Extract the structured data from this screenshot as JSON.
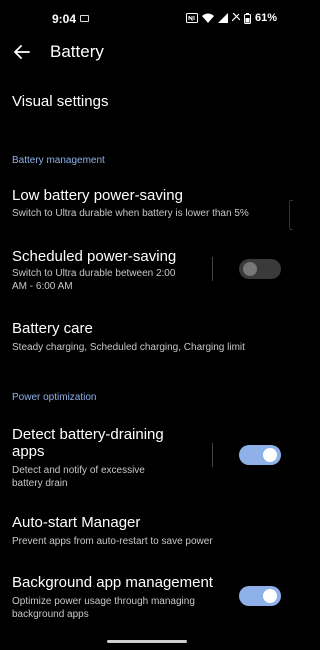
{
  "status_bar": {
    "time": "9:04",
    "battery_percent": "61%"
  },
  "app_bar": {
    "title": "Battery"
  },
  "visual_settings": {
    "title": "Visual settings"
  },
  "battery_management": {
    "header": "Battery management",
    "low_battery": {
      "title": "Low battery power-saving",
      "subtitle": "Switch to Ultra durable when battery is lower than 5%"
    },
    "scheduled": {
      "title": "Scheduled power-saving",
      "subtitle_line1": "Switch to Ultra durable between 2:00",
      "subtitle_line2": "AM - 6:00 AM",
      "enabled": false
    },
    "battery_care": {
      "title": "Battery care",
      "subtitle": "Steady charging, Scheduled charging, Charging limit"
    }
  },
  "power_optimization": {
    "header": "Power optimization",
    "detect": {
      "title_line1": "Detect battery-draining",
      "title_line2": "apps",
      "subtitle_line1": "Detect and notify of excessive",
      "subtitle_line2": "battery drain",
      "enabled": true
    },
    "autostart": {
      "title": "Auto-start Manager",
      "subtitle": "Prevent apps from auto-restart to save power"
    },
    "background": {
      "title": "Background app management",
      "subtitle_line1": "Optimize power usage through managing",
      "subtitle_line2": "background apps",
      "enabled": true
    }
  },
  "colors": {
    "accent": "#8fb1ea",
    "background": "#000000",
    "subtitle": "#c8c8c8"
  }
}
